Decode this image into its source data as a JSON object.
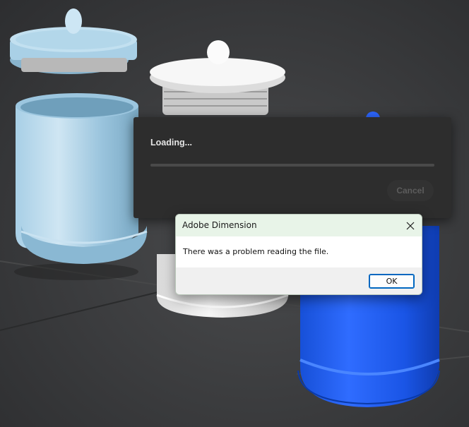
{
  "loading_panel": {
    "title": "Loading...",
    "progress": 0,
    "cancel_label": "Cancel"
  },
  "message_box": {
    "title": "Adobe Dimension",
    "message": "There was a problem reading the file.",
    "ok_label": "OK",
    "close_icon": "close-icon"
  },
  "scene": {
    "background_color": "#3a3b3d",
    "objects": [
      "light-blue-jar",
      "white-jar",
      "blue-jar"
    ]
  }
}
